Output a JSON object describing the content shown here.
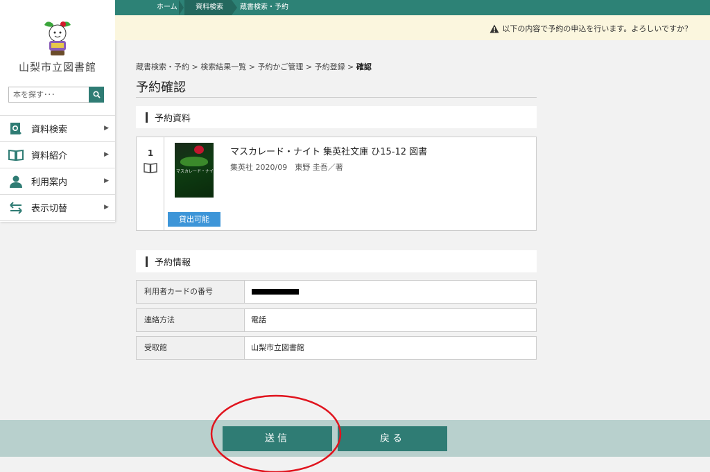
{
  "sidebar": {
    "library_name": "山梨市立図書館",
    "search_placeholder": "本を探す･･･",
    "nav_items": [
      {
        "label": "資料検索",
        "icon": "search-document-icon"
      },
      {
        "label": "資料紹介",
        "icon": "open-book-icon"
      },
      {
        "label": "利用案内",
        "icon": "user-icon"
      },
      {
        "label": "表示切替",
        "icon": "switch-arrows-icon"
      }
    ]
  },
  "topbar": {
    "crumbs": [
      "ホーム",
      "資料検索",
      "蔵書検索・予約"
    ]
  },
  "notice": {
    "text": "以下の内容で予約の申込を行います。よろしいですか？"
  },
  "main": {
    "breadcrumb": [
      "蔵書検索・予約",
      "検索結果一覧",
      "予約かご管理",
      "予約登録",
      "確認"
    ],
    "breadcrumb_separator": ">",
    "page_title": "予約確認",
    "materials_heading": "予約資料",
    "item": {
      "number": "1",
      "cover_text": "マスカレード・ナイト",
      "title": "マスカレード・ナイト 集英社文庫 ひ15-12 図書",
      "meta": "集英社 2020/09　東野 圭吾／著",
      "availability": "貸出可能"
    },
    "info_heading": "予約情報",
    "info_rows": [
      {
        "label": "利用者カードの番号",
        "value": ""
      },
      {
        "label": "連絡方法",
        "value": "電話"
      },
      {
        "label": "受取館",
        "value": "山梨市立図書館"
      }
    ]
  },
  "footer": {
    "submit_label": "送信",
    "back_label": "戻る"
  },
  "colors": {
    "brand": "#2d8276",
    "button": "#2f7c74",
    "footer_bg": "#b8d0cd",
    "notice_bg": "#fbf6de",
    "badge": "#3d95d8",
    "annotation": "#e0141e"
  }
}
